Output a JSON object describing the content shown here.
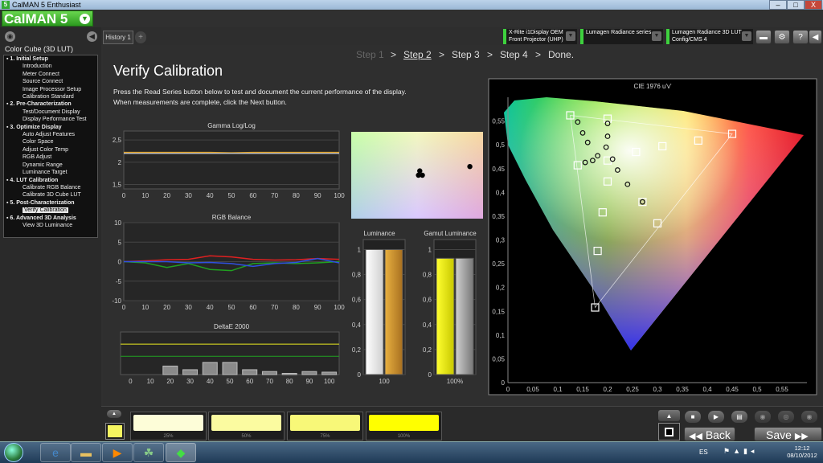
{
  "window": {
    "title": "CalMAN 5 Enthusiast",
    "app_icon": "5",
    "logo": "CalMAN 5",
    "minimize": "–",
    "maximize": "□",
    "close": "X"
  },
  "left": {
    "cube_label": "Color Cube (3D LUT)",
    "tree": [
      {
        "t": "sec",
        "label": "1. Initial Setup"
      },
      {
        "t": "item",
        "label": "Introduction"
      },
      {
        "t": "item",
        "label": "Meter Connect"
      },
      {
        "t": "item",
        "label": "Source Connect"
      },
      {
        "t": "item",
        "label": "Image Processor Setup"
      },
      {
        "t": "item",
        "label": "Calibration Standard"
      },
      {
        "t": "sec",
        "label": "2. Pre-Characterization"
      },
      {
        "t": "item",
        "label": "Test/Document Display"
      },
      {
        "t": "item",
        "label": "Display Performance Test"
      },
      {
        "t": "sec",
        "label": "3. Optimize Display"
      },
      {
        "t": "item",
        "label": "Auto Adjust Features"
      },
      {
        "t": "item",
        "label": "Color Space"
      },
      {
        "t": "item",
        "label": "Adjust Color Temp"
      },
      {
        "t": "item",
        "label": "RGB Adjust"
      },
      {
        "t": "item",
        "label": "Dynamic Range"
      },
      {
        "t": "item",
        "label": "Luminance Target"
      },
      {
        "t": "sec",
        "label": "4. LUT Calibration"
      },
      {
        "t": "item",
        "label": "Calibrate RGB Balance"
      },
      {
        "t": "item",
        "label": "Calibrate 3D Cube LUT"
      },
      {
        "t": "sec",
        "label": "5. Post-Characterization"
      },
      {
        "t": "sel",
        "label": "Verify Calibration"
      },
      {
        "t": "sec",
        "label": "6. Advanced 3D Analysis"
      },
      {
        "t": "item",
        "label": "View 3D Luminance"
      }
    ]
  },
  "tabs": {
    "history": "History 1",
    "add": "+"
  },
  "devices": [
    {
      "line1": "X-Rite i1Display OEM",
      "line2": "Front Projector (UHP)"
    },
    {
      "line1": "Lumagen Radiance series",
      "line2": ""
    },
    {
      "line1": "Lumagen Radiance 3D LUT",
      "line2": "Config/CMS 4"
    }
  ],
  "steps": {
    "s1": "Step 1",
    "s2": "Step 2",
    "s3": "Step 3",
    "s4": "Step 4",
    "done": "Done.",
    "sep": ">"
  },
  "main": {
    "title": "Verify Calibration",
    "instruction1": "Press the Read Series button below to test and document the current performance of the display.",
    "instruction2": "When measurements are complete, click the Next button."
  },
  "chart_data": [
    {
      "type": "line",
      "title": "Gamma Log/Log",
      "x": [
        0,
        10,
        20,
        30,
        40,
        50,
        60,
        70,
        80,
        90,
        100
      ],
      "ylim": [
        1.4,
        2.7
      ],
      "yticks": [
        "2,5",
        "2",
        "1,5"
      ],
      "series": [
        {
          "color": "#e0a020",
          "values": [
            2.22,
            2.22,
            2.22,
            2.22,
            2.22,
            2.21,
            2.22,
            2.22,
            2.22,
            2.22,
            2.22
          ]
        },
        {
          "color": "#bbbbbb",
          "values": [
            2.2,
            2.2,
            2.2,
            2.2,
            2.2,
            2.2,
            2.2,
            2.2,
            2.2,
            2.2,
            2.2
          ]
        }
      ]
    },
    {
      "type": "line",
      "title": "RGB Balance",
      "x": [
        0,
        10,
        20,
        30,
        40,
        50,
        60,
        70,
        80,
        90,
        100
      ],
      "ylim": [
        -10,
        10
      ],
      "yticks": [
        "10",
        "5",
        "0",
        "-5",
        "-10"
      ],
      "series": [
        {
          "color": "#e02020",
          "values": [
            0,
            0.2,
            0.5,
            0.6,
            1.5,
            1.2,
            0.6,
            0.4,
            0.5,
            0.8,
            0.6
          ]
        },
        {
          "color": "#20a020",
          "values": [
            0,
            -0.3,
            -1.5,
            -0.5,
            -2.0,
            -2.3,
            -0.5,
            -0.3,
            -0.5,
            -0.3,
            0
          ]
        },
        {
          "color": "#3050e0",
          "values": [
            0,
            0,
            0,
            -0.3,
            -0.2,
            -0.5,
            -1.2,
            -0.5,
            -0.2,
            0.8,
            -0.3
          ]
        }
      ]
    },
    {
      "type": "bar",
      "title": "DeltaE 2000",
      "categories": [
        "0",
        "10",
        "20",
        "30",
        "40",
        "50",
        "60",
        "70",
        "80",
        "90",
        "100"
      ],
      "values": [
        0,
        0,
        1.4,
        0.8,
        2.0,
        2.0,
        0.8,
        0.5,
        0.2,
        0.5,
        0.4
      ],
      "ylim": [
        0,
        7
      ],
      "threshold_lines": [
        {
          "y": 5,
          "color": "#e8e820"
        },
        {
          "y": 3,
          "color": "#20a020"
        }
      ]
    },
    {
      "type": "bar",
      "title": "Luminance",
      "categories": [
        "100"
      ],
      "series": [
        {
          "color": "#f0f0f0",
          "value": 1
        },
        {
          "color": "#d8a030",
          "value": 1
        }
      ],
      "yticks": [
        "1",
        "0,8",
        "0,6",
        "0,4",
        "0,2",
        "0"
      ]
    },
    {
      "type": "bar",
      "title": "Gamut Luminance",
      "categories": [
        "100%"
      ],
      "series": [
        {
          "color": "#f0f000",
          "value": 0.93
        },
        {
          "color": "#a8a8a8",
          "value": 0.93
        }
      ],
      "yticks": [
        "1",
        "0,8",
        "0,6",
        "0,4",
        "0,2",
        "0"
      ]
    },
    {
      "type": "scatter",
      "title": "CIE 1976 u'v'",
      "xlim": [
        0,
        0.6
      ],
      "ylim": [
        0,
        0.6
      ],
      "xticks": [
        "0",
        "0,05",
        "0,1",
        "0,15",
        "0,2",
        "0,25",
        "0,3",
        "0,35",
        "0,4",
        "0,45",
        "0,5",
        "0,55"
      ],
      "yticks": [
        "0,55",
        "0,5",
        "0,45",
        "0,4",
        "0,35",
        "0,3",
        "0,25",
        "0,2",
        "0,15",
        "0,1",
        "0,05",
        "0"
      ],
      "targets": [
        [
          0.125,
          0.562
        ],
        [
          0.45,
          0.523
        ],
        [
          0.175,
          0.158
        ],
        [
          0.2,
          0.555
        ],
        [
          0.14,
          0.457
        ],
        [
          0.382,
          0.509
        ],
        [
          0.31,
          0.497
        ],
        [
          0.257,
          0.485
        ],
        [
          0.2,
          0.423
        ],
        [
          0.19,
          0.358
        ],
        [
          0.18,
          0.277
        ],
        [
          0.3,
          0.335
        ],
        [
          0.27,
          0.38
        ],
        [
          0.2,
          0.467
        ]
      ],
      "measured": [
        [
          0.14,
          0.548
        ],
        [
          0.15,
          0.525
        ],
        [
          0.2,
          0.545
        ],
        [
          0.2,
          0.518
        ],
        [
          0.197,
          0.495
        ],
        [
          0.18,
          0.477
        ],
        [
          0.17,
          0.467
        ],
        [
          0.155,
          0.463
        ],
        [
          0.22,
          0.447
        ],
        [
          0.24,
          0.417
        ],
        [
          0.27,
          0.38
        ],
        [
          0.21,
          0.47
        ],
        [
          0.16,
          0.505
        ]
      ]
    }
  ],
  "gamut_inset": {
    "points": [
      [
        0.51,
        0.5
      ],
      [
        0.54,
        0.5
      ],
      [
        0.52,
        0.45
      ],
      [
        0.9,
        0.4
      ]
    ]
  },
  "swatches": [
    {
      "label": "",
      "color": "#f5f560"
    },
    {
      "label": "25%",
      "color": "#fdfdd8"
    },
    {
      "label": "50%",
      "color": "#fbfba0"
    },
    {
      "label": "75%",
      "color": "#f8f878"
    },
    {
      "label": "100%",
      "color": "#ffff00"
    }
  ],
  "buttons": {
    "back": "Back",
    "save": "Save"
  },
  "taskbar": {
    "lang": "ES",
    "time": "12:12",
    "date": "08/10/2012"
  }
}
